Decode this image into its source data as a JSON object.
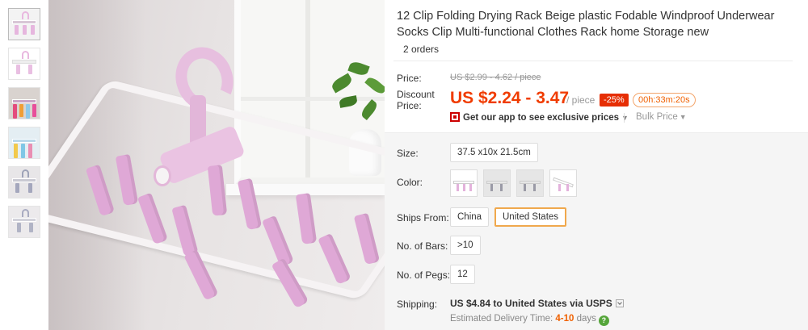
{
  "product": {
    "title": "12 Clip Folding Drying Rack Beige plastic Fodable Windproof Underwear Socks Clip Multi-functional Clothes Rack home Storage new",
    "orders": "2 orders"
  },
  "price": {
    "label": "Price:",
    "original": "US $2.99 - 4.62 / piece",
    "discount_label": "Discount Price:",
    "discount_label_line1": "Discount",
    "discount_label_line2": "Price:",
    "discounted": "US $2.24 - 3.47",
    "unit": "/ piece",
    "discount_pct": "-25%",
    "countdown": "00h:33m:20s",
    "app_promo": "Get our app to see exclusive prices",
    "bulk_price": "Bulk Price"
  },
  "options": {
    "size": {
      "label": "Size:",
      "value": "37.5 x10x 21.5cm"
    },
    "color": {
      "label": "Color:",
      "swatch_count": 4
    },
    "ships_from": {
      "label": "Ships From:",
      "options": [
        "China",
        "United States"
      ],
      "selected": "United States"
    },
    "bars": {
      "label": "No. of Bars:",
      "value": ">10"
    },
    "pegs": {
      "label": "No. of Pegs:",
      "value": "12"
    }
  },
  "shipping": {
    "label": "Shipping:",
    "amount": "US $4.84",
    "destination_text": "to United States via USPS",
    "delivery_prefix": "Estimated Delivery Time:",
    "delivery_days": "4-10",
    "delivery_suffix": "days"
  },
  "icons": {
    "app_qr": "qr-code-icon",
    "dropdown": "chevron-down-icon",
    "help": "question-circle-icon"
  },
  "colors": {
    "price_red": "#f03c00",
    "badge_red": "#e62e04",
    "selected_border": "#f0a84c",
    "rack_pink": "#e7bfdf",
    "help_green": "#55a53a"
  }
}
